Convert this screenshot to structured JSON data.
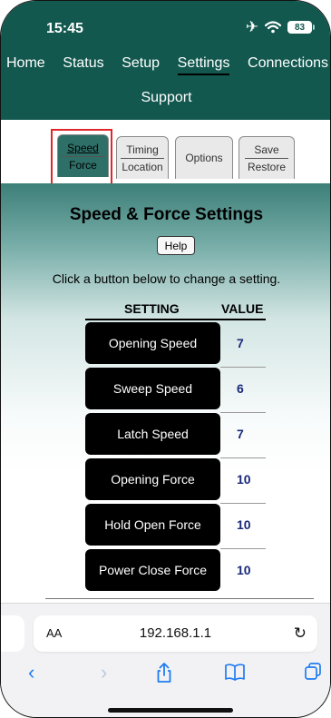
{
  "status_bar": {
    "time": "15:45",
    "battery": "83",
    "icons": [
      "airplane-icon",
      "wifi-icon",
      "battery-icon"
    ]
  },
  "nav": {
    "items": [
      "Home",
      "Status",
      "Setup",
      "Settings",
      "Connections"
    ],
    "second_row": "Support",
    "active": "Settings"
  },
  "tabs": [
    {
      "top": "Speed",
      "bottom": "Force",
      "active": true
    },
    {
      "top": "Timing",
      "bottom": "Location",
      "active": false
    },
    {
      "top": "Options",
      "bottom": "",
      "active": false
    },
    {
      "top": "Save",
      "bottom": "Restore",
      "active": false
    }
  ],
  "content": {
    "title": "Speed & Force Settings",
    "help_label": "Help",
    "instruction": "Click a button below to change a setting.",
    "col_setting": "SETTING",
    "col_value": "VALUE",
    "rows": [
      {
        "setting": "Opening Speed",
        "value": "7"
      },
      {
        "setting": "Sweep Speed",
        "value": "6"
      },
      {
        "setting": "Latch Speed",
        "value": "7"
      },
      {
        "setting": "Opening Force",
        "value": "10"
      },
      {
        "setting": "Hold Open Force",
        "value": "10"
      },
      {
        "setting": "Power Close Force",
        "value": "10"
      }
    ]
  },
  "browser": {
    "text_size_label": "AA",
    "url": "192.168.1.1",
    "toolbar_icons": [
      "back-icon",
      "forward-icon",
      "share-icon",
      "bookmarks-icon",
      "tabs-icon"
    ]
  },
  "colors": {
    "header": "#12584f",
    "active_tab": "#2e6f68",
    "highlight": "#e0262b",
    "value_text": "#1a2a7a"
  }
}
